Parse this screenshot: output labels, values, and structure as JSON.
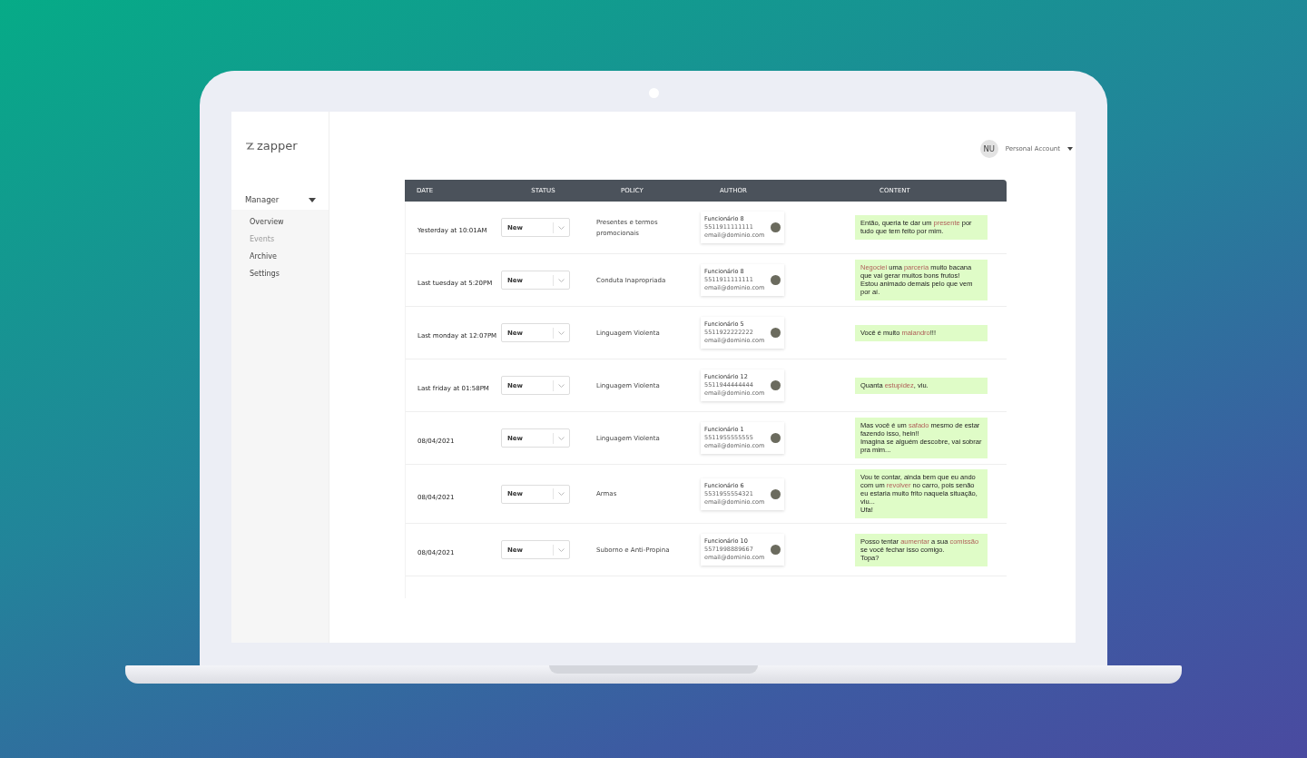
{
  "logo": "zapper",
  "account": {
    "initials": "NU",
    "label": "Personal Account"
  },
  "sidebar": {
    "section": {
      "label": "Manager",
      "expanded": true
    },
    "items": [
      {
        "label": "Overview",
        "disabled": false
      },
      {
        "label": "Events",
        "disabled": true
      },
      {
        "label": "Archive",
        "disabled": false
      },
      {
        "label": "Settings",
        "disabled": false
      }
    ]
  },
  "table": {
    "columns": [
      "DATE",
      "STATUS",
      "POLICY",
      "AUTHOR",
      "CONTENT"
    ],
    "rows": [
      {
        "date": "Yesterday at 10:01AM",
        "status": "New",
        "policy": "Presentes e termos promocionais",
        "author": {
          "name": "Funcionário 8",
          "phone": "5511911111111",
          "email": "email@dominio.com"
        },
        "content": [
          {
            "text": "Então, queria te dar um ",
            "flagged": false
          },
          {
            "text": "presente",
            "flagged": true
          },
          {
            "text": " por tudo que tem feito por mim.",
            "flagged": false
          }
        ]
      },
      {
        "date": "Last tuesday at 5:20PM",
        "status": "New",
        "policy": "Conduta Inapropriada",
        "author": {
          "name": "Funcionário 8",
          "phone": "5511911111111",
          "email": "email@dominio.com"
        },
        "content": [
          {
            "text": "Negociei",
            "flagged": true
          },
          {
            "text": " uma ",
            "flagged": false
          },
          {
            "text": "parceria",
            "flagged": true
          },
          {
            "text": " muito bacana que vai gerar muitos bons frutos!\nEstou animado demais pelo que vem por aí.",
            "flagged": false
          }
        ]
      },
      {
        "date": "Last monday at 12:07PM",
        "status": "New",
        "policy": "Linguagem Violenta",
        "author": {
          "name": "Funcionário 5",
          "phone": "5511922222222",
          "email": "email@dominio.com"
        },
        "content": [
          {
            "text": "Você é muito ",
            "flagged": false
          },
          {
            "text": "malandro",
            "flagged": true
          },
          {
            "text": "!!!",
            "flagged": false
          }
        ]
      },
      {
        "date": "Last friday at 01:58PM",
        "status": "New",
        "policy": "Linguagem Violenta",
        "author": {
          "name": "Funcionário 12",
          "phone": "5511944444444",
          "email": "email@dominio.com"
        },
        "content": [
          {
            "text": "Quanta ",
            "flagged": false
          },
          {
            "text": "estupidez",
            "flagged": true
          },
          {
            "text": ", viu.",
            "flagged": false
          }
        ]
      },
      {
        "date": "08/04/2021",
        "status": "New",
        "policy": "Linguagem Violenta",
        "author": {
          "name": "Funcionário 1",
          "phone": "5511955555555",
          "email": "email@dominio.com"
        },
        "content": [
          {
            "text": "Mas você é um ",
            "flagged": false
          },
          {
            "text": "safado",
            "flagged": true
          },
          {
            "text": " mesmo de estar fazendo isso, hein!!\nImagina se alguém descobre, vai sobrar pra mim...",
            "flagged": false
          }
        ]
      },
      {
        "date": "08/04/2021",
        "status": "New",
        "policy": "Armas",
        "author": {
          "name": "Funcionário 6",
          "phone": "5531955554321",
          "email": "email@dominio.com"
        },
        "content": [
          {
            "text": "Vou te contar, ainda bem que eu ando com um ",
            "flagged": false
          },
          {
            "text": "revolver",
            "flagged": true
          },
          {
            "text": " no carro, pois senão eu estaria muito frito naquela situação, viu...\nUfa!",
            "flagged": false
          }
        ]
      },
      {
        "date": "08/04/2021",
        "status": "New",
        "policy": "Suborno e Anti-Propina",
        "author": {
          "name": "Funcionário 10",
          "phone": "5571998889667",
          "email": "email@dominio.com"
        },
        "content": [
          {
            "text": "Posso tentar ",
            "flagged": false
          },
          {
            "text": "aumentar",
            "flagged": true
          },
          {
            "text": " a sua ",
            "flagged": false
          },
          {
            "text": "comissão",
            "flagged": true
          },
          {
            "text": "\nse você fechar isso comigo.\nTopa?",
            "flagged": false
          }
        ]
      }
    ]
  }
}
